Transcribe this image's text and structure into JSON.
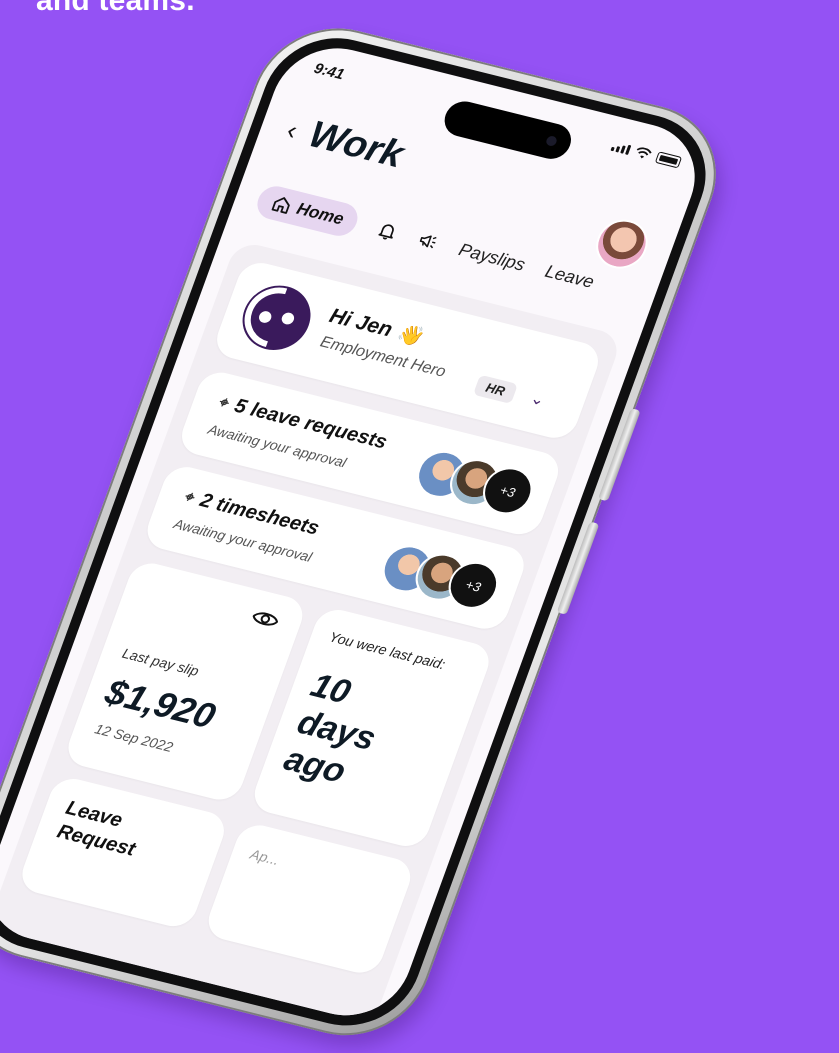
{
  "headline": "and teams.",
  "status_bar": {
    "time": "9:41"
  },
  "header": {
    "title": "Work",
    "back_icon": "chevron-left-icon"
  },
  "tabs": [
    {
      "label": "Home",
      "icon": "home-icon",
      "active": true
    },
    {
      "label": "",
      "icon": "bell-icon"
    },
    {
      "label": "",
      "icon": "megaphone-icon"
    },
    {
      "label": "Payslips"
    },
    {
      "label": "Leave"
    }
  ],
  "profile": {
    "greeting": "Hi Jen",
    "emoji": "👋",
    "organization": "Employment Hero",
    "role_badge": "HR"
  },
  "requests": [
    {
      "title": "5 leave requests",
      "subtitle": "Awaiting your approval",
      "more_count": "+3"
    },
    {
      "title": "2 timesheets",
      "subtitle": "Awaiting your approval",
      "more_count": "+3"
    }
  ],
  "payslip": {
    "label": "Last pay slip",
    "amount": "$1,920",
    "date": "12 Sep 2022"
  },
  "last_paid": {
    "label": "You were last paid:",
    "line1": "10",
    "line2": "days",
    "line3": "ago"
  },
  "leave_card": {
    "line1": "Leave",
    "line2": "Request"
  },
  "partial_card": {
    "label": "Ap..."
  },
  "colors": {
    "background": "#9452F4",
    "accent": "#3A1A5C",
    "tab_active": "#E6D6F0"
  }
}
